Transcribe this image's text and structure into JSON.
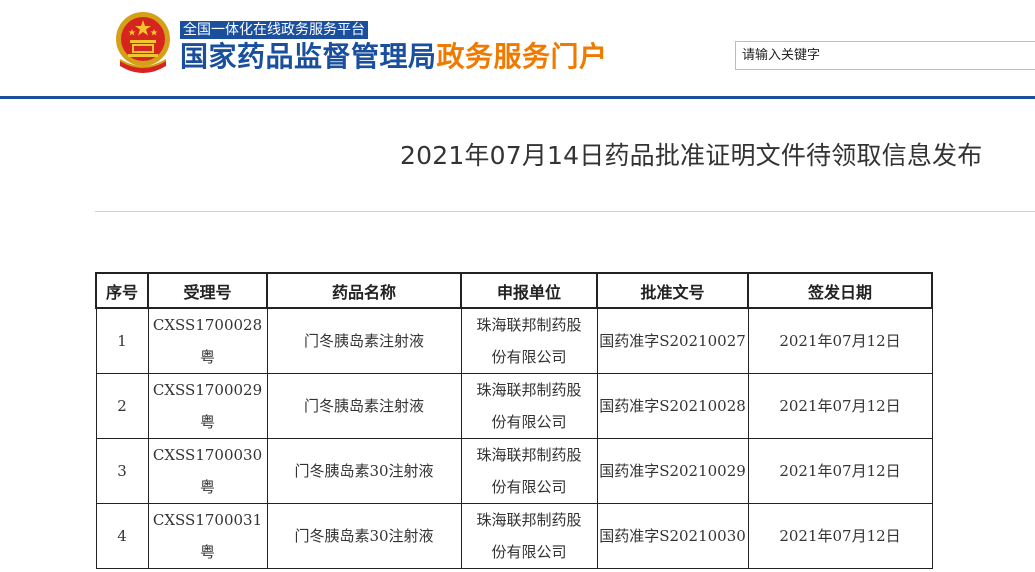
{
  "header": {
    "platform_tag": "全国一体化在线政务服务平台",
    "title_main": "国家药品监督管理局",
    "title_sub": "政务服务门户",
    "search_placeholder": "请输入关键字",
    "brand_blue": "#1a4f9e",
    "brand_orange": "#f07a00",
    "emblem_icon": "national-emblem-icon"
  },
  "article": {
    "title": "2021年07月14日药品批准证明文件待领取信息发布"
  },
  "table": {
    "headers": [
      "序号",
      "受理号",
      "药品名称",
      "申报单位",
      "批准文号",
      "签发日期"
    ],
    "rows": [
      {
        "no": "1",
        "acceptance": "CXSS1700028粤",
        "drug": "门冬胰岛素注射液",
        "applicant": "珠海联邦制药股份有限公司",
        "approval": "国药准字S20210027",
        "date": "2021年07月12日"
      },
      {
        "no": "2",
        "acceptance": "CXSS1700029粤",
        "drug": "门冬胰岛素注射液",
        "applicant": "珠海联邦制药股份有限公司",
        "approval": "国药准字S20210028",
        "date": "2021年07月12日"
      },
      {
        "no": "3",
        "acceptance": "CXSS1700030粤",
        "drug": "门冬胰岛素30注射液",
        "applicant": "珠海联邦制药股份有限公司",
        "approval": "国药准字S20210029",
        "date": "2021年07月12日"
      },
      {
        "no": "4",
        "acceptance": "CXSS1700031粤",
        "drug": "门冬胰岛素30注射液",
        "applicant": "珠海联邦制药股份有限公司",
        "approval": "国药准字S20210030",
        "date": "2021年07月12日"
      }
    ]
  }
}
